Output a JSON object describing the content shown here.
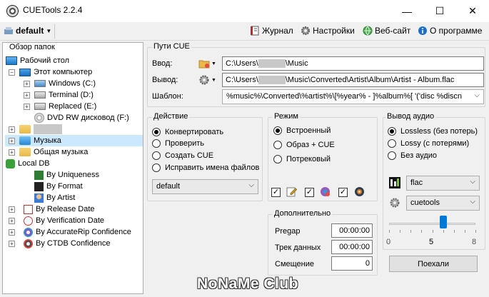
{
  "window": {
    "title": "CUETools 2.2.4",
    "minimize": "—",
    "maximize": "☐",
    "close": "✕"
  },
  "toolbar": {
    "profile": "default",
    "journal": "Журнал",
    "settings": "Настройки",
    "website": "Веб-сайт",
    "about": "О программе"
  },
  "browser": {
    "legend": "Обзор папок",
    "items": [
      {
        "label": "Рабочий стол"
      },
      {
        "label": "Этот компьютер"
      },
      {
        "label": "Windows (C:)"
      },
      {
        "label": "Terminal (D:)"
      },
      {
        "label": "Replaced (E:)"
      },
      {
        "label": "DVD RW дисковод (F:)"
      },
      {
        "label": "Музыка"
      },
      {
        "label": "Общая музыка"
      },
      {
        "label": "Local DB"
      },
      {
        "label": "By Uniqueness"
      },
      {
        "label": "By Format"
      },
      {
        "label": "By Artist"
      },
      {
        "label": "By Release Date"
      },
      {
        "label": "By Verification Date"
      },
      {
        "label": "By AccurateRip Confidence"
      },
      {
        "label": "By CTDB Confidence"
      }
    ]
  },
  "paths": {
    "legend": "Пути CUE",
    "input_label": "Ввод:",
    "output_label": "Вывод:",
    "template_label": "Шаблон:",
    "input_value_pre": "C:\\Users\\",
    "input_value_post": "\\Music",
    "output_value_pre": "C:\\Users\\",
    "output_value_post": "\\Music\\Converted\\Artist\\Album\\Artist - Album.flac",
    "template_value": "%music%\\Converted\\%artist%\\[%year% - ]%album%[ '('disc %discn"
  },
  "action": {
    "legend": "Действие",
    "options": [
      "Конвертировать",
      "Проверить",
      "Создать CUE",
      "Исправить имена файлов"
    ],
    "selected": 0,
    "profile": "default"
  },
  "mode": {
    "legend": "Режим",
    "options": [
      "Встроенный",
      "Образ + CUE",
      "Потрековый"
    ],
    "selected": 0
  },
  "audio": {
    "legend": "Вывод аудио",
    "options": [
      "Lossless (без потерь)",
      "Lossy (с потерями)",
      "Без аудио"
    ],
    "selected": 0,
    "format": "flac",
    "encoder": "cuetools",
    "slider_min": "0",
    "slider_value": "5",
    "slider_max": "8",
    "level": 5
  },
  "extra": {
    "legend": "Дополнительно",
    "pregap_label": "Pregap",
    "pregap_value": "00:00:00",
    "track_label": "Трек данных",
    "track_value": "00:00:00",
    "offset_label": "Смещение",
    "offset_value": "0"
  },
  "go_button": "Поехали",
  "watermark": "NoNaMe Club",
  "icons": {
    "accent": "#1c6fc0"
  }
}
